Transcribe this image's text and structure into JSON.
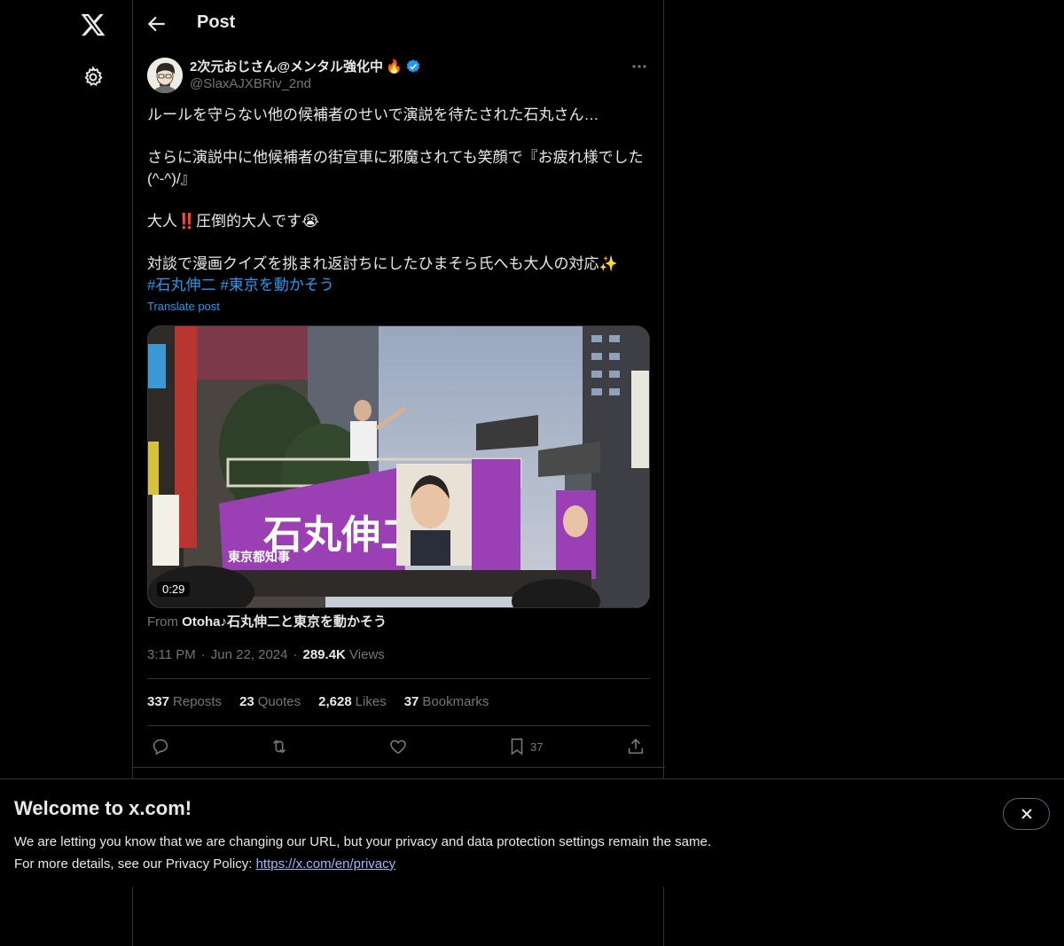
{
  "header": {
    "title": "Post"
  },
  "author": {
    "display_name": "2次元おじさん@メンタル強化中",
    "emoji": "🔥",
    "handle": "@SlaxAJXBRiv_2nd"
  },
  "tweet": {
    "text": "ルールを守らない他の候補者のせいで演説を待たされた石丸さん…\n\nさらに演説中に他候補者の街宣車に邪魔されても笑顔で『お疲れ様でした(^-^)/』\n\n大人‼️圧倒的大人です😭\n\n対談で漫画クイズを挑まれ返討ちにしたひまそら氏へも大人の対応✨",
    "hashtags": [
      "#石丸伸二",
      "#東京を動かそう"
    ],
    "translate_label": "Translate post"
  },
  "media": {
    "duration": "0:29",
    "from_label": "From",
    "from_name": "Otoha♪石丸伸二と東京を動かそう",
    "truck_text_main": "石丸伸二",
    "truck_text_sub": "東京都知事",
    "truck_text_slogan": "東京を動かそう"
  },
  "meta": {
    "time": "3:11 PM",
    "date": "Jun 22, 2024",
    "views_count": "289.4K",
    "views_label": "Views",
    "separator": "·"
  },
  "stats": {
    "reposts_count": "337",
    "reposts_label": "Reposts",
    "quotes_count": "23",
    "quotes_label": "Quotes",
    "likes_count": "2,628",
    "likes_label": "Likes",
    "bookmarks_count": "37",
    "bookmarks_label": "Bookmarks"
  },
  "actions": {
    "bookmark_count": "37"
  },
  "banner": {
    "title": "Welcome to x.com!",
    "line1": "We are letting you know that we are changing our URL, but your privacy and data protection settings remain the same.",
    "line2_prefix": "For more details, see our Privacy Policy: ",
    "link": "https://x.com/en/privacy"
  },
  "colors": {
    "accent": "#1d9bf0",
    "background": "#000000",
    "muted": "#71767b",
    "border": "#2f3336",
    "candidate_purple": "#9b3fb5"
  },
  "icons": [
    "x-logo-icon",
    "settings-gear-icon",
    "back-arrow-icon",
    "verified-badge-icon",
    "more-icon",
    "reply-icon",
    "repost-icon",
    "like-icon",
    "bookmark-icon",
    "share-icon",
    "close-icon"
  ]
}
